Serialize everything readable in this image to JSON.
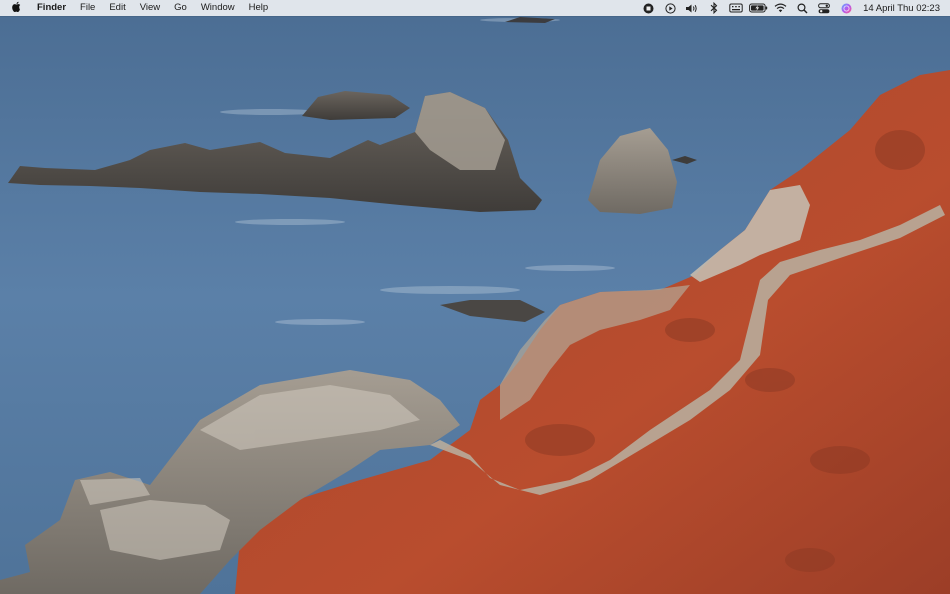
{
  "menubar": {
    "app_name": "Finder",
    "menus": [
      "File",
      "Edit",
      "View",
      "Go",
      "Window",
      "Help"
    ],
    "status_icons": [
      "screen-record-icon",
      "play-icon",
      "volume-icon",
      "bluetooth-icon",
      "keyboard-input-icon",
      "battery-charging-icon",
      "wifi-icon",
      "spotlight-search-icon",
      "control-center-icon",
      "siri-icon"
    ],
    "clock": "14 April Thu  02:23"
  },
  "wallpaper": {
    "description_colors": {
      "sea": "#5a7ea6",
      "rock": "#8c857c",
      "ice_plant": "#b44a2c",
      "trail": "#b9ad9c"
    }
  }
}
